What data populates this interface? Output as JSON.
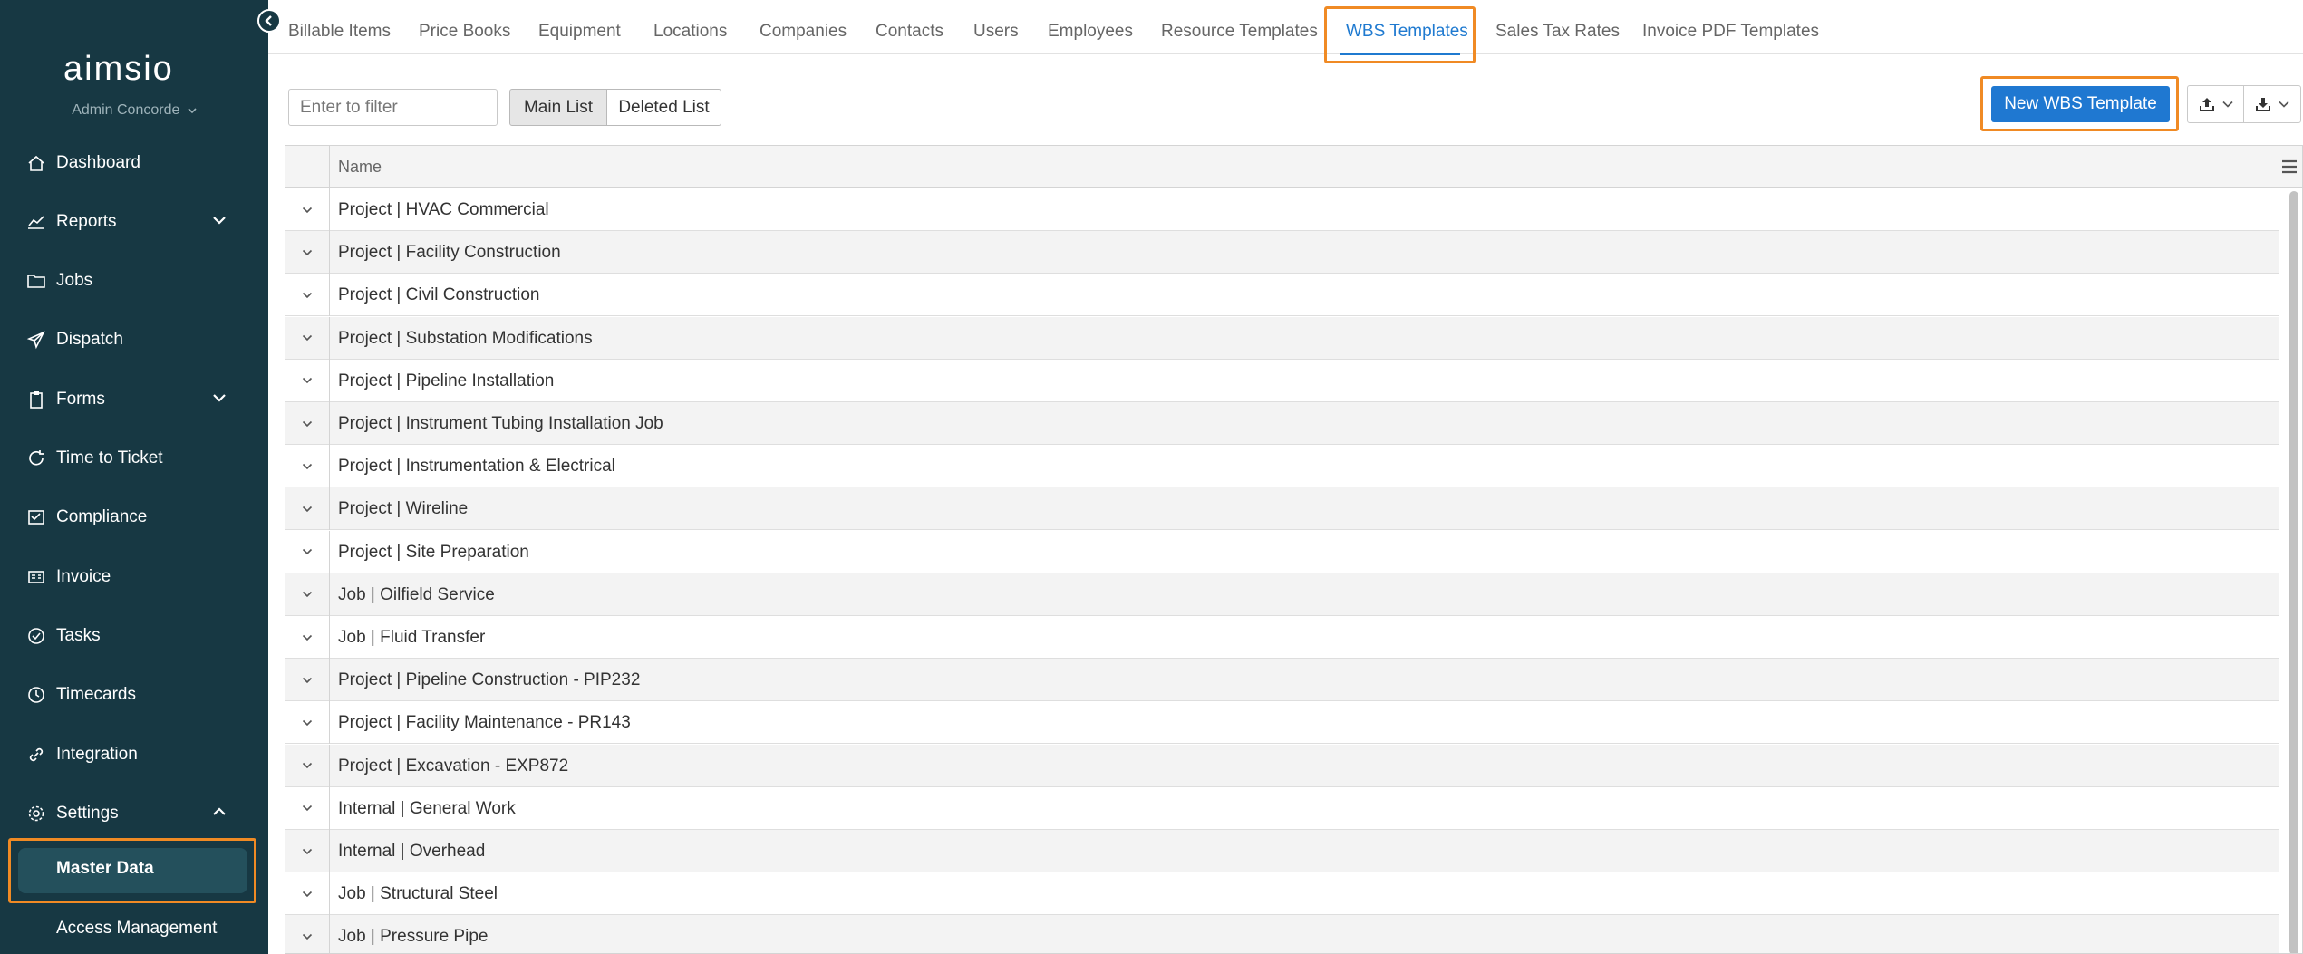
{
  "app": {
    "logo_text": "aimsio",
    "user_name": "Admin Concorde"
  },
  "sidebar": {
    "items": [
      {
        "label": "Dashboard",
        "icon": "home-icon",
        "expandable": false
      },
      {
        "label": "Reports",
        "icon": "chart-icon",
        "expandable": true,
        "expanded": false
      },
      {
        "label": "Jobs",
        "icon": "folder-icon",
        "expandable": false
      },
      {
        "label": "Dispatch",
        "icon": "send-icon",
        "expandable": false
      },
      {
        "label": "Forms",
        "icon": "clipboard-icon",
        "expandable": true,
        "expanded": false
      },
      {
        "label": "Time to Ticket",
        "icon": "cycle-icon",
        "expandable": false
      },
      {
        "label": "Compliance",
        "icon": "checklist-icon",
        "expandable": false
      },
      {
        "label": "Invoice",
        "icon": "invoice-icon",
        "expandable": false
      },
      {
        "label": "Tasks",
        "icon": "check-circle-icon",
        "expandable": false
      },
      {
        "label": "Timecards",
        "icon": "clock-icon",
        "expandable": false
      },
      {
        "label": "Integration",
        "icon": "link-icon",
        "expandable": false
      },
      {
        "label": "Settings",
        "icon": "gear-icon",
        "expandable": true,
        "expanded": true
      }
    ],
    "settings_children": [
      {
        "label": "Master Data",
        "active": true
      },
      {
        "label": "Access Management",
        "active": false
      }
    ]
  },
  "tabs": [
    {
      "label": "Billable Items",
      "active": false
    },
    {
      "label": "Price Books",
      "active": false
    },
    {
      "label": "Equipment",
      "active": false
    },
    {
      "label": "Locations",
      "active": false
    },
    {
      "label": "Companies",
      "active": false
    },
    {
      "label": "Contacts",
      "active": false
    },
    {
      "label": "Users",
      "active": false
    },
    {
      "label": "Employees",
      "active": false
    },
    {
      "label": "Resource Templates",
      "active": false
    },
    {
      "label": "WBS Templates",
      "active": true
    },
    {
      "label": "Sales Tax Rates",
      "active": false
    },
    {
      "label": "Invoice PDF Templates",
      "active": false
    }
  ],
  "toolbar": {
    "filter_placeholder": "Enter to filter",
    "main_list_label": "Main List",
    "deleted_list_label": "Deleted List",
    "selected_list": "Main List",
    "new_button_label": "New WBS Template",
    "upload_icon": "upload-icon",
    "download_icon": "download-icon"
  },
  "grid": {
    "columns": [
      "Name"
    ],
    "rows": [
      "Project | HVAC Commercial",
      "Project | Facility Construction",
      "Project | Civil Construction",
      "Project | Substation Modifications",
      "Project | Pipeline Installation",
      "Project | Instrument Tubing Installation Job",
      "Project | Instrumentation & Electrical",
      "Project | Wireline",
      "Project | Site Preparation",
      "Job | Oilfield Service",
      "Job | Fluid Transfer",
      "Project | Pipeline Construction - PIP232",
      "Project | Facility Maintenance - PR143",
      "Project | Excavation - EXP872",
      "Internal | General Work",
      "Internal | Overhead",
      "Job | Structural Steel",
      "Job | Pressure Pipe"
    ]
  },
  "colors": {
    "sidebar_bg": "#173843",
    "accent_blue": "#1f78d1",
    "highlight_orange": "#f08a24"
  }
}
